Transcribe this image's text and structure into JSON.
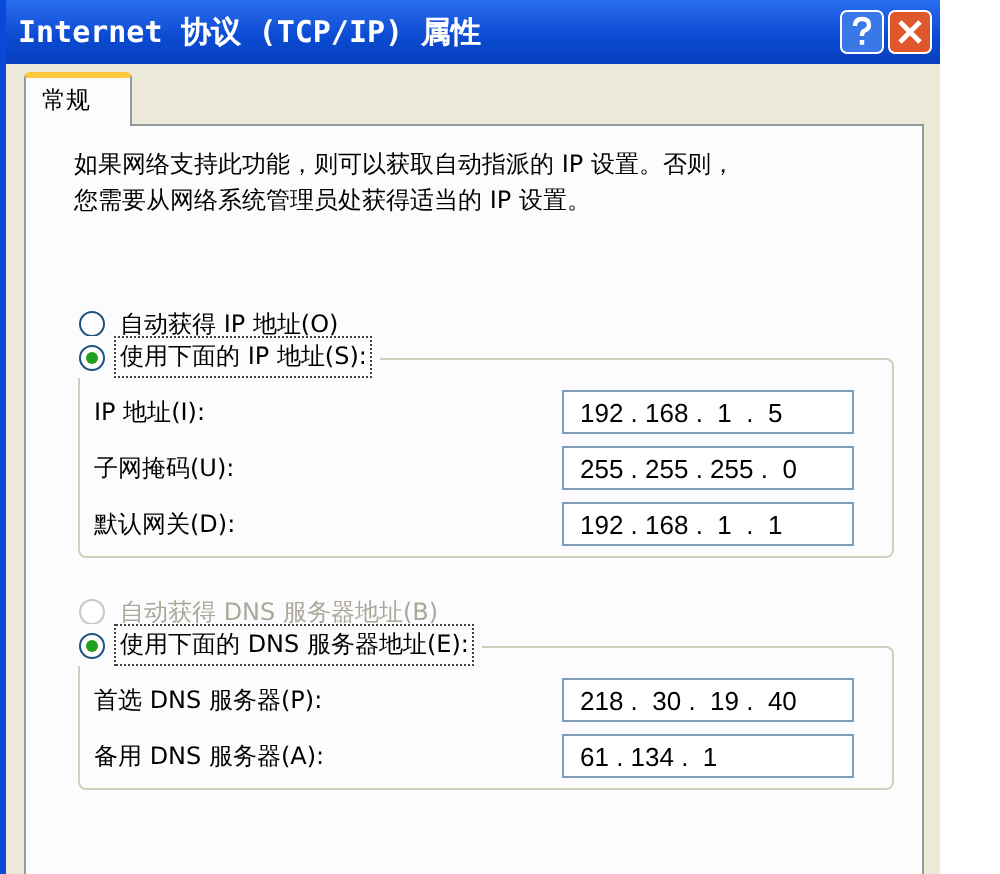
{
  "window": {
    "title": "Internet 协议 (TCP/IP) 属性"
  },
  "tabs": [
    {
      "label": "常规",
      "selected": true
    }
  ],
  "intro": [
    "如果网络支持此功能，则可以获取自动指派的 IP 设置。否则，",
    "您需要从网络系统管理员处获得适当的 IP 设置。"
  ],
  "ip_mode": [
    {
      "label": "自动获得 IP 地址(O)",
      "selected": false,
      "disabled": false
    },
    {
      "label": "使用下面的 IP 地址(S):",
      "selected": true,
      "disabled": false
    }
  ],
  "ip_fields": [
    {
      "label": "IP 地址(I):",
      "value": "192 . 168 .  1  .  5"
    },
    {
      "label": "子网掩码(U):",
      "value": "255 . 255 . 255 .  0"
    },
    {
      "label": "默认网关(D):",
      "value": "192 . 168 .  1  .  1"
    }
  ],
  "dns_mode": [
    {
      "label": "自动获得 DNS 服务器地址(B)",
      "selected": false,
      "disabled": true
    },
    {
      "label": "使用下面的 DNS 服务器地址(E):",
      "selected": true,
      "disabled": false
    }
  ],
  "dns_fields": [
    {
      "label": "首选 DNS 服务器(P):",
      "value": "218 .  30 .  19 .  40"
    },
    {
      "label": "备用 DNS 服务器(A):",
      "value": "61 . 134 .  1"
    }
  ]
}
